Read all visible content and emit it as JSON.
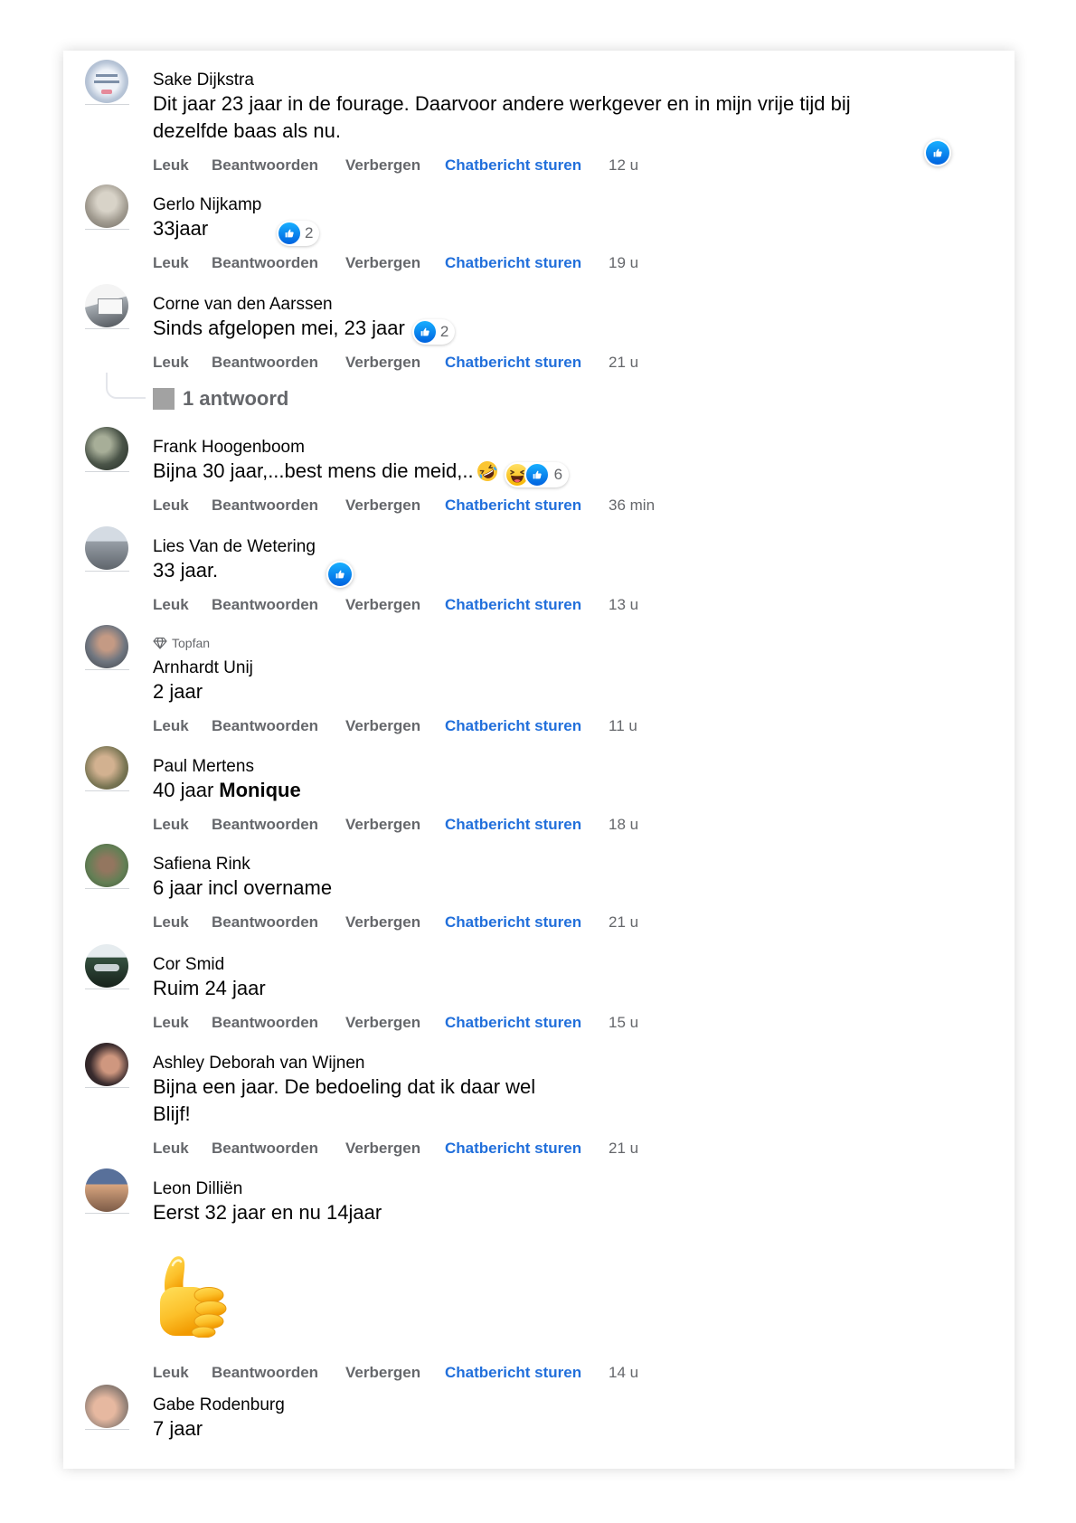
{
  "actions": {
    "like": "Leuk",
    "reply": "Beantwoorden",
    "hide": "Verbergen",
    "message": "Chatbericht sturen"
  },
  "colors": {
    "link_blue": "#216fdb",
    "like_blue": "#0866ff",
    "muted_text": "#65676b",
    "body_text": "#050505"
  },
  "comments": [
    {
      "author": "Sake Dijkstra",
      "text": "Dit jaar 23 jaar in de fourage. Daarvoor andere werkgever en in mijn vrije tijd bij\ndezelfde baas als nu.",
      "time": "12 u",
      "reactions": [
        "like-icon"
      ]
    },
    {
      "author": "Gerlo Nijkamp",
      "text": "33jaar",
      "time": "19 u",
      "reactions": [
        "like-icon"
      ],
      "reaction_count": "2"
    },
    {
      "author": "Corne van den Aarssen",
      "text": "Sinds afgelopen mei, 23 jaar",
      "time": "21 u",
      "reactions": [
        "like-icon"
      ],
      "reaction_count": "2",
      "replies_label": "1 antwoord"
    },
    {
      "author": "Frank Hoogenboom",
      "text": "Bijna 30 jaar,...best mens die meid,..",
      "emoji": "rolling-on-floor-laughing-icon",
      "time": "36 min",
      "reactions": [
        "haha-icon",
        "like-icon"
      ],
      "reaction_count": "6"
    },
    {
      "author": "Lies Van de Wetering",
      "text": "33 jaar.",
      "time": "13 u",
      "reactions": [
        "like-icon"
      ]
    },
    {
      "badge": "Topfan",
      "badge_icon": "diamond-icon",
      "author": "Arnhardt Unij",
      "text": "2 jaar",
      "time": "11 u"
    },
    {
      "author": "Paul Mertens",
      "text": "40 jaar",
      "mention": "Monique",
      "time": "18 u"
    },
    {
      "author": "Safiena Rink",
      "text": "6 jaar incl overname",
      "time": "21 u"
    },
    {
      "author": "Cor Smid",
      "text": "Ruim 24 jaar",
      "time": "15 u"
    },
    {
      "author": "Ashley Deborah van Wijnen",
      "text": "Bijna een jaar. De bedoeling dat ik daar wel\nBlijf!",
      "time": "21 u"
    },
    {
      "author": "Leon Dilliën",
      "text": "Eerst 32 jaar en nu 14jaar",
      "sticker": "thumbs-up-emoji-icon",
      "time": "14 u"
    },
    {
      "author": "Gabe Rodenburg",
      "text": "7 jaar"
    }
  ]
}
